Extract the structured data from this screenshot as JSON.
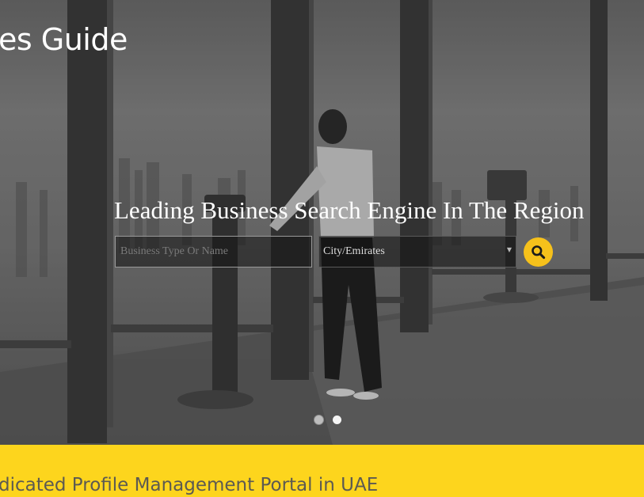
{
  "header": {
    "site_title": "es Guide"
  },
  "hero": {
    "tagline": "Leading Business Search Engine In The Region",
    "search": {
      "placeholder": "Business Type Or Name",
      "value": ""
    },
    "city_select": {
      "selected": "City/Emirates",
      "arrow": "▼"
    },
    "search_button": {
      "icon": "search-icon",
      "color": "#f6c11b"
    },
    "slider": {
      "total": 2,
      "active": 1
    }
  },
  "banner": {
    "text": "dicated Profile Management Portal in UAE",
    "background": "#fdd51d"
  }
}
